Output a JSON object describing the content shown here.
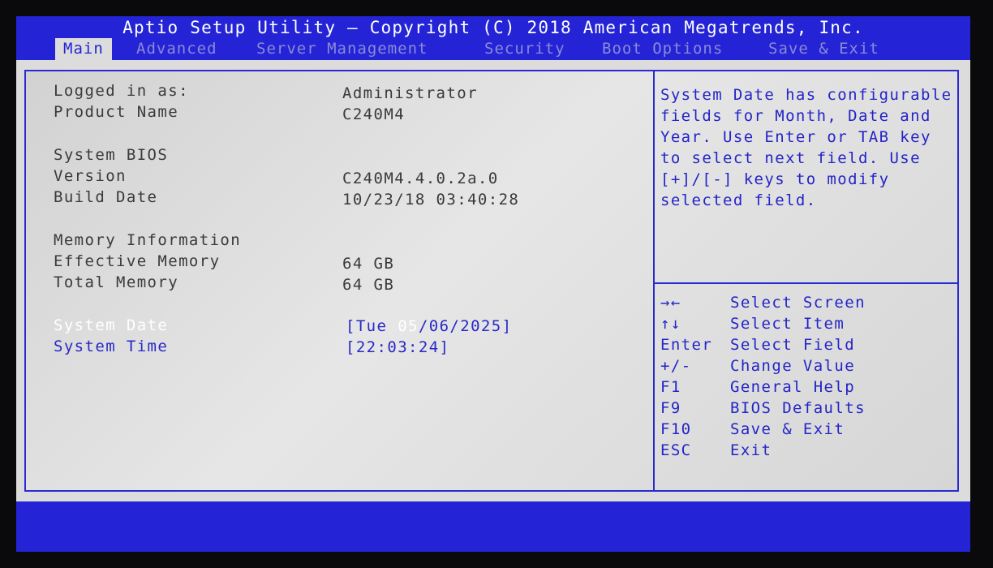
{
  "header": {
    "title": "Aptio Setup Utility – Copyright (C) 2018 American Megatrends, Inc."
  },
  "tabs": [
    "Main",
    "Advanced",
    "Server Management",
    "Security",
    "Boot Options",
    "Save & Exit"
  ],
  "active_tab": "Main",
  "info": {
    "logged_in_label": "Logged in as:",
    "logged_in_value": "Administrator",
    "product_name_label": "Product Name",
    "product_name_value": "C240M4",
    "system_bios_heading": "System BIOS",
    "version_label": "Version",
    "version_value": "C240M4.4.0.2a.0",
    "build_date_label": "Build Date",
    "build_date_value": "10/23/18 03:40:28",
    "memory_heading": "Memory Information",
    "effective_memory_label": "Effective Memory",
    "effective_memory_value": "64 GB",
    "total_memory_label": "Total Memory",
    "total_memory_value": "64 GB",
    "system_date_label": "System Date",
    "system_date_value_pre": "[Tue ",
    "system_date_value_sel": "05",
    "system_date_value_post": "/06/2025]",
    "system_time_label": "System Time",
    "system_time_value": "[22:03:24]"
  },
  "help": {
    "text": "System Date has configurable fields for Month, Date and Year. Use Enter or TAB key to select next field. Use [+]/[-] keys to modify selected field."
  },
  "keys": [
    {
      "key": "→←",
      "desc": "Select Screen"
    },
    {
      "key": "↑↓",
      "desc": "Select Item"
    },
    {
      "key": "Enter",
      "desc": "Select Field"
    },
    {
      "key": "+/-",
      "desc": "Change Value"
    },
    {
      "key": "F1",
      "desc": "General Help"
    },
    {
      "key": "F9",
      "desc": "BIOS Defaults"
    },
    {
      "key": "F10",
      "desc": "Save & Exit"
    },
    {
      "key": "ESC",
      "desc": "Exit"
    }
  ],
  "colors": {
    "header_bg": "#2424d6",
    "panel_bg": "#dcdcdc",
    "accent_text": "#2424c8",
    "inactive_tab": "#8a8ad8"
  }
}
